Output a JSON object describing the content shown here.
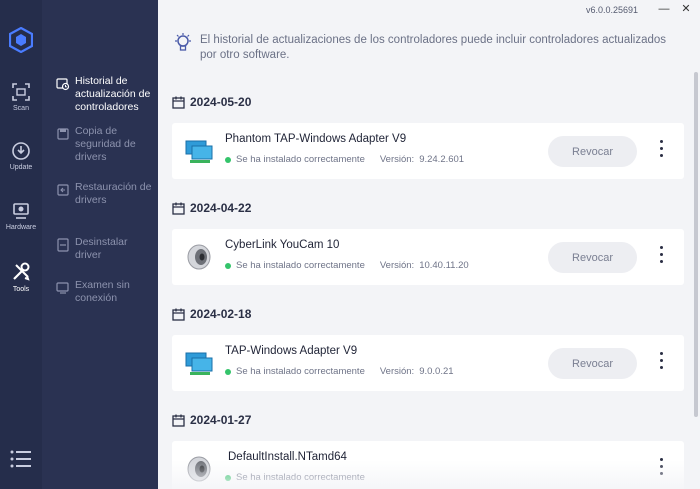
{
  "app": {
    "version": "v6.0.0.25691",
    "window_controls": {
      "minimize": "—",
      "close": "✕"
    }
  },
  "rail": {
    "items": [
      {
        "label": "Scan",
        "icon": "scan-icon"
      },
      {
        "label": "Update",
        "icon": "update-icon"
      },
      {
        "label": "Hardware",
        "icon": "hardware-icon"
      },
      {
        "label": "Tools",
        "icon": "tools-icon"
      }
    ],
    "active": "Tools"
  },
  "subnav": {
    "items": [
      {
        "label": "Historial de actualización de controladores",
        "icon": "history-icon",
        "active": true
      },
      {
        "label": "Copia de seguridad de drivers",
        "icon": "backup-icon",
        "active": false
      },
      {
        "label": "Restauración de drivers",
        "icon": "restore-icon",
        "active": false
      },
      {
        "label": "Desinstalar driver",
        "icon": "uninstall-icon",
        "active": false
      },
      {
        "label": "Examen sin conexión",
        "icon": "offline-scan-icon",
        "active": false
      }
    ]
  },
  "notice": {
    "text": "El historial de actualizaciones de los controladores puede incluir controladores actualizados por otro software."
  },
  "history": {
    "status_label": "Se ha instalado correctamente",
    "version_label": "Versión:",
    "revoke_label": "Revocar",
    "groups": [
      {
        "date": "2024-05-20",
        "driver": {
          "name": "Phantom TAP-Windows Adapter V9",
          "version": "9.24.2.601",
          "icon": "network-adapter-icon"
        }
      },
      {
        "date": "2024-04-22",
        "driver": {
          "name": "CyberLink YouCam 10",
          "version": "10.40.11.20",
          "icon": "speaker-icon"
        }
      },
      {
        "date": "2024-02-18",
        "driver": {
          "name": "TAP-Windows Adapter V9",
          "version": "9.0.0.21",
          "icon": "network-adapter-icon"
        }
      },
      {
        "date": "2024-01-27",
        "driver": {
          "name": "DefaultInstall.NTamd64",
          "version": "",
          "icon": "speaker-icon"
        }
      }
    ]
  },
  "colors": {
    "rail_bg": "#252d4b",
    "subnav_bg": "#2a3252",
    "main_bg": "#f3f4f7",
    "success": "#34c46b",
    "brand": "#4a7cff"
  }
}
